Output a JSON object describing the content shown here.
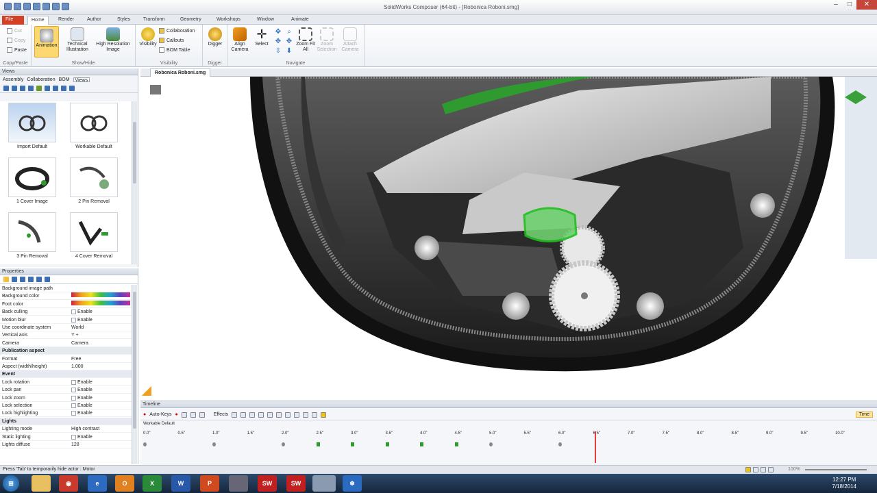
{
  "window": {
    "title": "SolidWorks Composer (64-bit) - [Robonica Roboni.smg]"
  },
  "ribbon_tabs": [
    "File",
    "Home",
    "Render",
    "Author",
    "Styles",
    "Transform",
    "Geometry",
    "Workshops",
    "Window",
    "Animate"
  ],
  "clipboard": {
    "cut": "Cut",
    "copy": "Copy",
    "paste": "Paste",
    "label": "Copy/Paste"
  },
  "showhide": {
    "animation": "Animation",
    "technical": "Technical Illustration",
    "highres": "High Resolution Image",
    "label": "Show/Hide"
  },
  "visibility": {
    "visibility": "Visibility",
    "collaboration": "Collaboration",
    "callouts": "Callouts",
    "bom_table": "BOM Table",
    "label": "Visibility"
  },
  "digger": {
    "button": "Digger",
    "label": "Digger"
  },
  "navigate": {
    "align": "Align Camera",
    "select": "Select",
    "zoom_fit": "Zoom Fit All",
    "zoom_sel": "Zoom Selection",
    "attach": "Attach Camera",
    "label": "Navigate"
  },
  "views_panel": {
    "title": "Views",
    "subtabs": [
      "Assembly",
      "Collaboration",
      "BOM",
      "Views"
    ],
    "thumbnails": [
      "Import Default",
      "Workable Default",
      "1 Cover Image",
      "2 Pin Removal",
      "3 Pin Removal",
      "4 Cover Removal"
    ]
  },
  "properties": {
    "title": "Properties",
    "rows": [
      {
        "k": "Background image path",
        "v": ""
      },
      {
        "k": "Background color",
        "v": "grad"
      },
      {
        "k": "Foot color",
        "v": "grad"
      },
      {
        "k": "Back culling",
        "v": "Enable"
      },
      {
        "k": "Motion blur",
        "v": "Enable"
      },
      {
        "k": "Use coordinate system",
        "v": "World"
      },
      {
        "k": "Vertical axis",
        "v": "Y +"
      },
      {
        "k": "Camera",
        "v": "Camera"
      },
      {
        "k": "Publication aspect",
        "v": "",
        "sec": true
      },
      {
        "k": "Format",
        "v": "Free"
      },
      {
        "k": "Aspect (width/height)",
        "v": "1.000"
      },
      {
        "k": "Event",
        "v": "",
        "sec": true
      },
      {
        "k": "Lock rotation",
        "v": "Enable"
      },
      {
        "k": "Lock pan",
        "v": "Enable"
      },
      {
        "k": "Lock zoom",
        "v": "Enable"
      },
      {
        "k": "Lock selection",
        "v": "Enable"
      },
      {
        "k": "Lock highlighting",
        "v": "Enable"
      },
      {
        "k": "Lights",
        "v": "",
        "sec": true
      },
      {
        "k": "Lighting mode",
        "v": "High contrast"
      },
      {
        "k": "Static lighting",
        "v": "Enable"
      },
      {
        "k": "Lights diffuse",
        "v": "128"
      }
    ]
  },
  "document": {
    "tab": "Robonica Roboni.smg"
  },
  "timeline": {
    "title": "Timeline",
    "autokeys": "Auto-Keys",
    "effects": "Effects",
    "time": "Time",
    "track": "Workable Default",
    "ticks": [
      "0.0\"",
      "0.5\"",
      "1.0\"",
      "1.5\"",
      "2.0\"",
      "2.5\"",
      "3.0\"",
      "3.5\"",
      "4.0\"",
      "4.5\"",
      "5.0\"",
      "5.5\"",
      "6.0\"",
      "6.5\"",
      "7.0\"",
      "7.5\"",
      "8.0\"",
      "8.5\"",
      "9.0\"",
      "9.5\"",
      "10.0\""
    ]
  },
  "status": {
    "text": "Press 'Tab' to temporarily hide actor : Motor",
    "zoom": "100%"
  },
  "taskbar": {
    "time": "12:27 PM",
    "date": "7/18/2014"
  },
  "colors": {
    "accent": "#d24026",
    "highlight": "#f5c400",
    "green": "#2f9a2f",
    "playhead": "#e23c3c"
  }
}
